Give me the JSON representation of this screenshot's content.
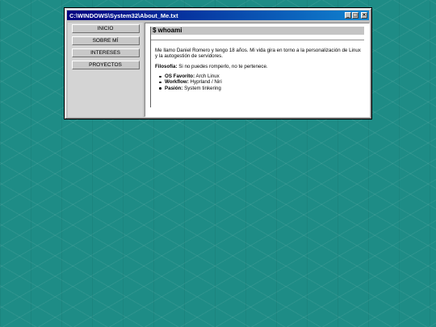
{
  "window": {
    "title": "C:\\WINDOWS\\System32\\About_Me.txt",
    "buttons": {
      "minimize": "_",
      "maximize": "□",
      "close": "×"
    }
  },
  "sidebar": {
    "items": [
      {
        "label": "INICIO"
      },
      {
        "label": "SOBRE MÍ"
      },
      {
        "label": "INTERESES"
      },
      {
        "label": "PROYECTOS"
      }
    ]
  },
  "content": {
    "heading": "$ whoami",
    "intro": "Me llamo Daniel Romero y tengo 18 años. Mi vida gira en torno a la personalización de Linux y la autogestión de servidores.",
    "philosophy_label": "Filosofía:",
    "philosophy_text": " Si no puedes romperlo, no te pertenece.",
    "facts": [
      {
        "label": "OS Favorito:",
        "value": " Arch Linux"
      },
      {
        "label": "Workflow:",
        "value": " Hyprland / Niri"
      },
      {
        "label": "Pasión:",
        "value": " System tinkering"
      }
    ]
  },
  "colors": {
    "desktop": "#1e8c86",
    "titlebar_start": "#000080",
    "titlebar_end": "#1084d0",
    "window_face": "#c0c0c0"
  }
}
